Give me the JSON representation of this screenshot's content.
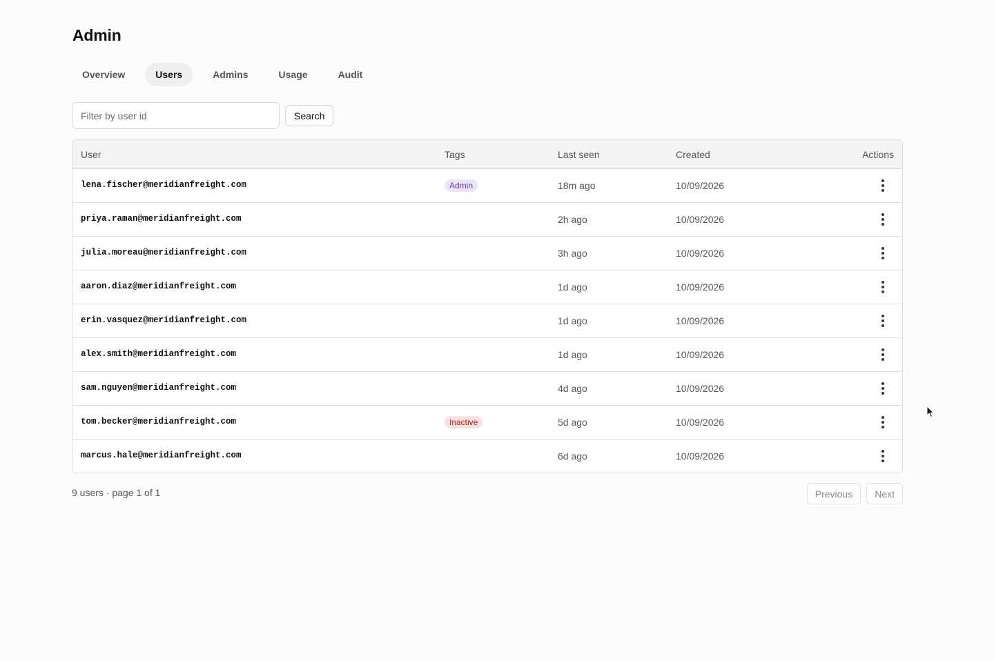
{
  "page": {
    "title": "Admin"
  },
  "tabs": [
    {
      "label": "Overview"
    },
    {
      "label": "Users"
    },
    {
      "label": "Admins"
    },
    {
      "label": "Usage"
    },
    {
      "label": "Audit"
    }
  ],
  "active_tab": "Users",
  "filter": {
    "placeholder": "Filter by user id",
    "value": "",
    "button_label": "Search"
  },
  "table": {
    "headers": {
      "user": "User",
      "tags": "Tags",
      "last_seen": "Last seen",
      "created": "Created",
      "actions": "Actions"
    },
    "rows": [
      {
        "user": "lena.fischer@meridianfreight.com",
        "tag": "Admin",
        "tag_kind": "admin",
        "last_seen": "18m ago",
        "created": "10/09/2026"
      },
      {
        "user": "priya.raman@meridianfreight.com",
        "tag": "",
        "tag_kind": "",
        "last_seen": "2h ago",
        "created": "10/09/2026"
      },
      {
        "user": "julia.moreau@meridianfreight.com",
        "tag": "",
        "tag_kind": "",
        "last_seen": "3h ago",
        "created": "10/09/2026"
      },
      {
        "user": "aaron.diaz@meridianfreight.com",
        "tag": "",
        "tag_kind": "",
        "last_seen": "1d ago",
        "created": "10/09/2026"
      },
      {
        "user": "erin.vasquez@meridianfreight.com",
        "tag": "",
        "tag_kind": "",
        "last_seen": "1d ago",
        "created": "10/09/2026"
      },
      {
        "user": "alex.smith@meridianfreight.com",
        "tag": "",
        "tag_kind": "",
        "last_seen": "1d ago",
        "created": "10/09/2026"
      },
      {
        "user": "sam.nguyen@meridianfreight.com",
        "tag": "",
        "tag_kind": "",
        "last_seen": "4d ago",
        "created": "10/09/2026"
      },
      {
        "user": "tom.becker@meridianfreight.com",
        "tag": "Inactive",
        "tag_kind": "inactive",
        "last_seen": "5d ago",
        "created": "10/09/2026"
      },
      {
        "user": "marcus.hale@meridianfreight.com",
        "tag": "",
        "tag_kind": "",
        "last_seen": "6d ago",
        "created": "10/09/2026"
      }
    ]
  },
  "footer": {
    "summary": "9 users · page 1 of 1",
    "previous_label": "Previous",
    "next_label": "Next"
  },
  "icons": {
    "row_actions": "kebab-menu-icon",
    "cursor": "mouse-pointer-icon"
  },
  "colors": {
    "admin_badge_bg": "#ece4f7",
    "admin_badge_text": "#6a3fa8",
    "inactive_badge_bg": "#fbe1e1",
    "inactive_badge_text": "#b42318"
  }
}
